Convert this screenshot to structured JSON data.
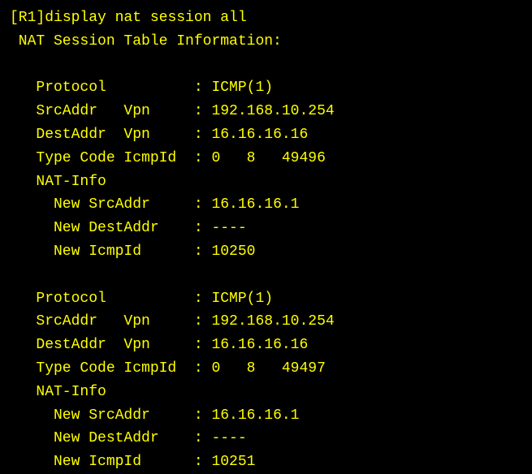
{
  "prompt_prefix": "[R1]",
  "command": "display nat session all",
  "header": " NAT Session Table Information:",
  "sessions": [
    {
      "protocol_label": "   Protocol          : ",
      "protocol_value": "ICMP(1)",
      "src_label": "   SrcAddr   Vpn     : ",
      "src_value": "192.168.10.254",
      "dest_label": "   DestAddr  Vpn     : ",
      "dest_value": "16.16.16.16",
      "type_label": "   Type Code IcmpId  : ",
      "type_value": "0   8   49496",
      "natinfo_label": "   NAT-Info",
      "newsrc_label": "     New SrcAddr     : ",
      "newsrc_value": "16.16.16.1",
      "newdest_label": "     New DestAddr    : ",
      "newdest_value": "----",
      "newicmp_label": "     New IcmpId      : ",
      "newicmp_value": "10250"
    },
    {
      "protocol_label": "   Protocol          : ",
      "protocol_value": "ICMP(1)",
      "src_label": "   SrcAddr   Vpn     : ",
      "src_value": "192.168.10.254",
      "dest_label": "   DestAddr  Vpn     : ",
      "dest_value": "16.16.16.16",
      "type_label": "   Type Code IcmpId  : ",
      "type_value": "0   8   49497",
      "natinfo_label": "   NAT-Info",
      "newsrc_label": "     New SrcAddr     : ",
      "newsrc_value": "16.16.16.1",
      "newdest_label": "     New DestAddr    : ",
      "newdest_value": "----",
      "newicmp_label": "     New IcmpId      : ",
      "newicmp_value": "10251"
    }
  ]
}
